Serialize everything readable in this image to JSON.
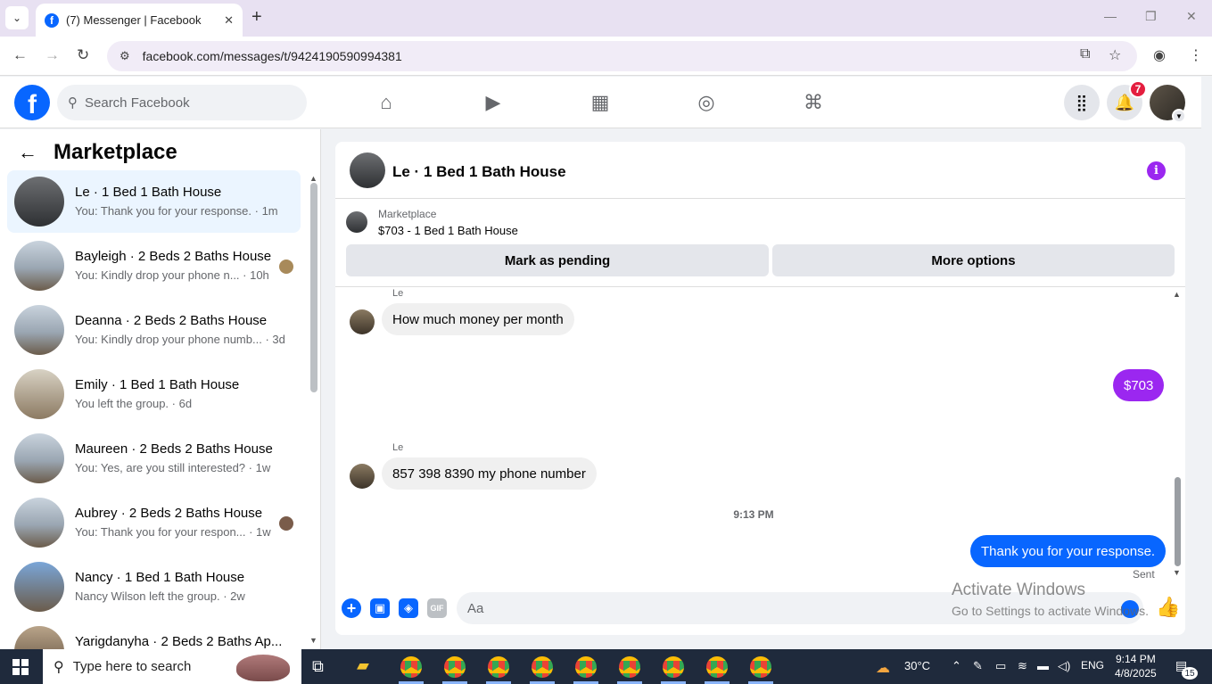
{
  "browser": {
    "tab_title": "(7) Messenger | Facebook",
    "url": "facebook.com/messages/t/9424190590994381"
  },
  "fb": {
    "logo": "f",
    "search_placeholder": "Search Facebook",
    "notification_count": "7",
    "nav_icons": [
      "home-icon",
      "watch-icon",
      "marketplace-icon",
      "groups-icon",
      "gaming-icon"
    ]
  },
  "sidebar": {
    "title": "Marketplace",
    "conversations": [
      {
        "name": "Le · 1 Bed 1 Bath House",
        "preview": "You: Thank you for your response. · 1m",
        "active": true
      },
      {
        "name": "Bayleigh · 2 Beds 2 Baths House",
        "preview": "You: Kindly drop your phone n... · 10h"
      },
      {
        "name": "Deanna · 2 Beds 2 Baths House",
        "preview": "You: Kindly drop your phone numb... · 3d"
      },
      {
        "name": "Emily · 1 Bed 1 Bath House",
        "preview": "You left the group. · 6d"
      },
      {
        "name": "Maureen · 2 Beds 2 Baths House",
        "preview": "You: Yes, are you still interested? · 1w"
      },
      {
        "name": "Aubrey · 2 Beds 2 Baths House",
        "preview": "You: Thank you for your respon... · 1w"
      },
      {
        "name": "Nancy · 1 Bed 1 Bath House",
        "preview": "Nancy Wilson left the group. · 2w"
      },
      {
        "name": "Yarigdanyha · 2 Beds 2 Baths Ap...",
        "preview": ""
      }
    ]
  },
  "chat": {
    "title": "Le · 1 Bed 1 Bath House",
    "marketplace_label": "Marketplace",
    "listing": "$703 - 1 Bed 1 Bath House",
    "mark_pending": "Mark as pending",
    "more_options": "More options",
    "messages": [
      {
        "sender": "Le",
        "text": "How much money per month"
      },
      {
        "sender": "You",
        "text": "$703"
      },
      {
        "sender": "Le",
        "text": "857 398 8390 my phone number"
      },
      {
        "sender": "You",
        "text": "Thank you for your response."
      }
    ],
    "timestamp": "9:13 PM",
    "sent_status": "Sent",
    "composer_placeholder": "Aa",
    "gif_label": "GIF"
  },
  "watermark": {
    "line1": "Activate Windows",
    "line2": "Go to Settings to activate Windows."
  },
  "taskbar": {
    "search_placeholder": "Type here to search",
    "temperature": "30°C",
    "language": "ENG",
    "time": "9:14 PM",
    "date": "4/8/2025",
    "notification_count": "15"
  },
  "colors": {
    "fb_blue": "#0866ff",
    "purple_bubble": "#9b27f0",
    "active_conv": "#ebf5ff"
  }
}
